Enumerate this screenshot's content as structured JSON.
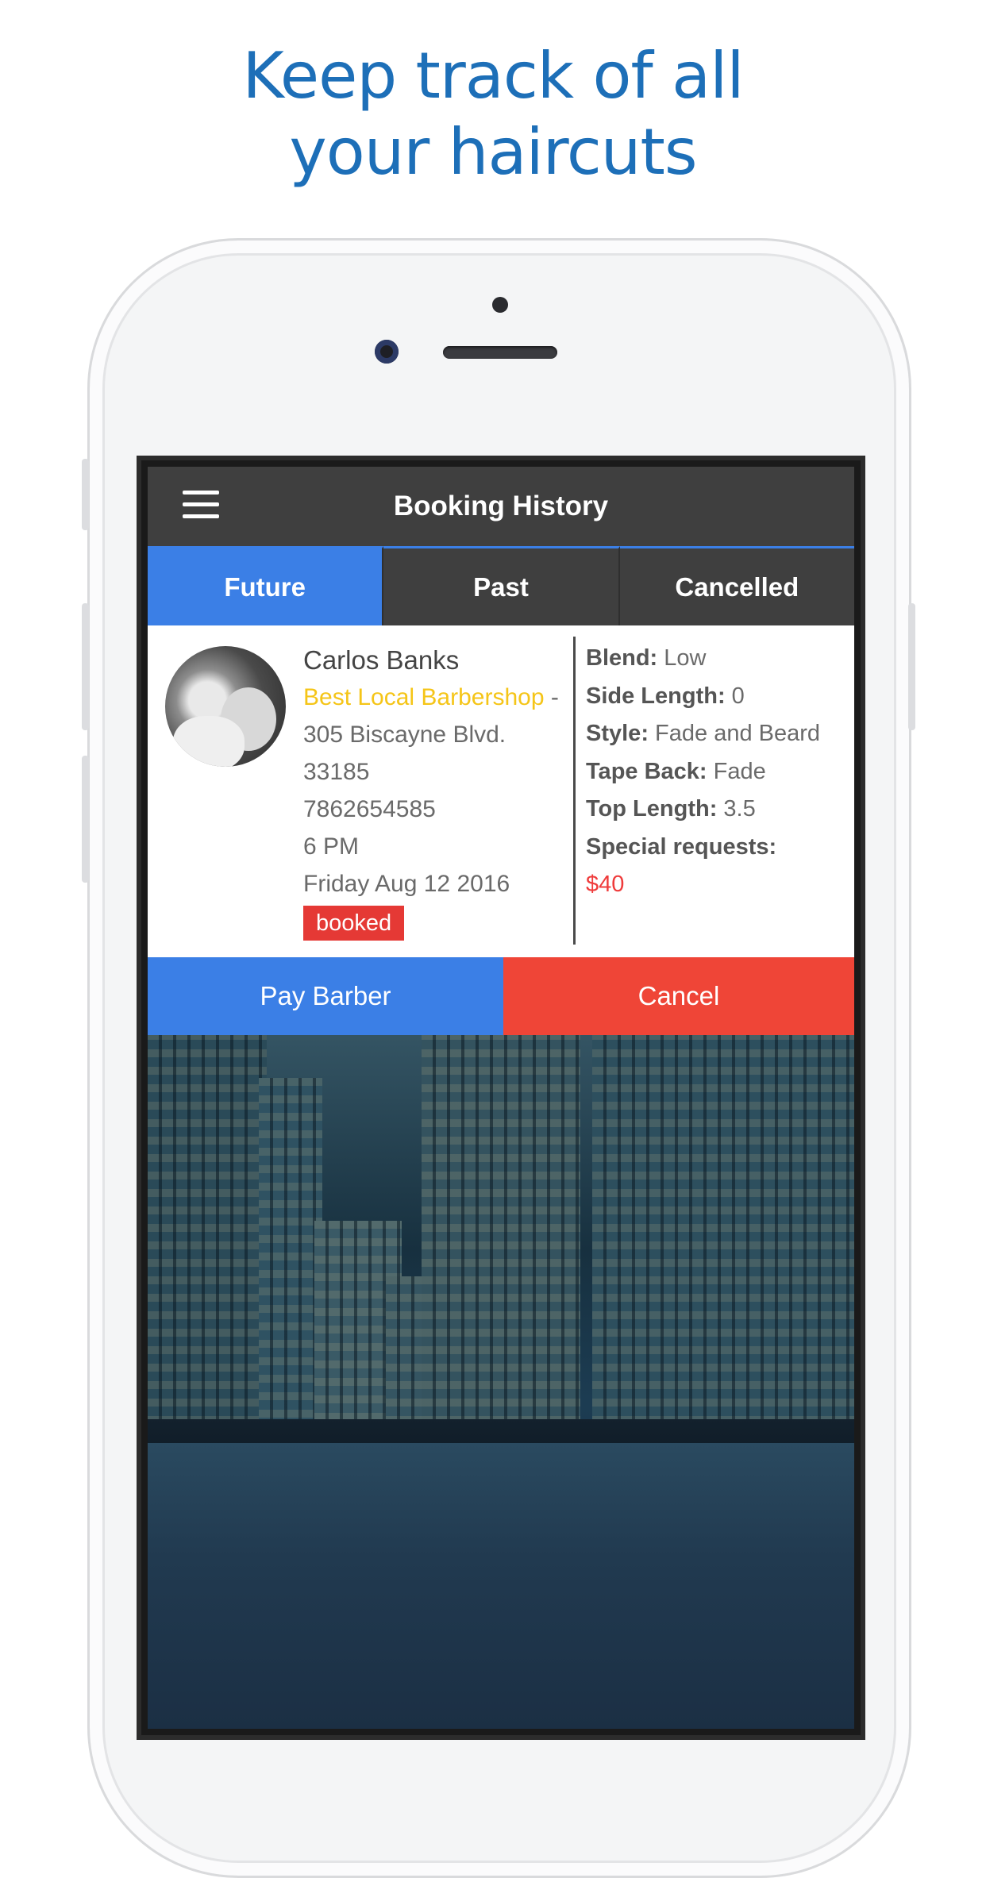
{
  "headline": {
    "line1": "Keep track of all",
    "line2": "your haircuts"
  },
  "app": {
    "title": "Booking History",
    "menu_icon": "hamburger-menu-icon",
    "tabs": [
      {
        "label": "Future",
        "active": true
      },
      {
        "label": "Past",
        "active": false
      },
      {
        "label": "Cancelled",
        "active": false
      }
    ]
  },
  "booking": {
    "client_name": "Carlos Banks",
    "shop_name": "Best Local Barbershop",
    "shop_separator": " -",
    "address_line1": "305 Biscayne Blvd.",
    "address_line2": "33185",
    "phone": "7862654585",
    "time": "6 PM",
    "date": "Friday Aug 12 2016",
    "status": "booked",
    "details": {
      "blend_label": "Blend:",
      "blend_value": " Low",
      "side_label": "Side Length:",
      "side_value": " 0",
      "style_label": "Style:",
      "style_value": " Fade and Beard",
      "tape_label": "Tape Back:",
      "tape_value": " Fade",
      "top_label": "Top Length:",
      "top_value": " 3.5",
      "requests_label": "Special requests:"
    },
    "price": "$40"
  },
  "actions": {
    "pay_label": "Pay Barber",
    "cancel_label": "Cancel"
  },
  "colors": {
    "headline": "#1d6fb8",
    "accent_blue": "#3b7fe6",
    "cancel_red": "#ef4537",
    "shop_yellow": "#f5c518",
    "toolbar": "#3f3f3f"
  }
}
